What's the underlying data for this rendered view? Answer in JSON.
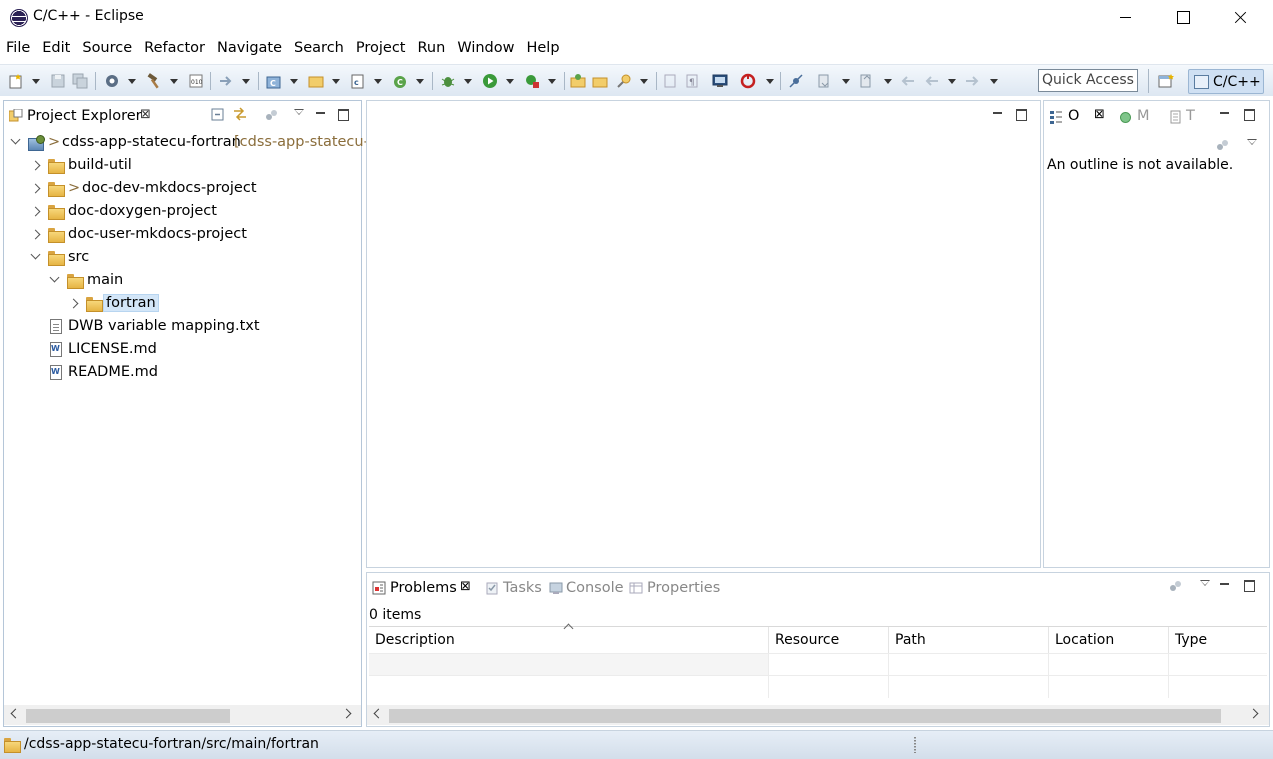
{
  "window": {
    "title": "C/C++ - Eclipse"
  },
  "menu": [
    "File",
    "Edit",
    "Source",
    "Refactor",
    "Navigate",
    "Search",
    "Project",
    "Run",
    "Window",
    "Help"
  ],
  "toolbar": {
    "quick_access_placeholder": "Quick Access",
    "perspective_label": "C/C++"
  },
  "project_explorer": {
    "tab_label": "Project Explorer",
    "tree": [
      {
        "label": "cdss-app-statecu-fortran",
        "suffix": "[cdss-app-statecu-",
        "prefix": ">",
        "level": 0,
        "state": "open",
        "icon": "project-icon"
      },
      {
        "label": "build-util",
        "prefix": "",
        "level": 1,
        "state": "closed",
        "icon": "folder-icon"
      },
      {
        "label": "doc-dev-mkdocs-project",
        "prefix": ">",
        "level": 1,
        "state": "closed",
        "icon": "folder-icon"
      },
      {
        "label": "doc-doxygen-project",
        "prefix": "",
        "level": 1,
        "state": "closed",
        "icon": "folder-icon"
      },
      {
        "label": "doc-user-mkdocs-project",
        "prefix": "",
        "level": 1,
        "state": "closed",
        "icon": "folder-icon"
      },
      {
        "label": "src",
        "prefix": "",
        "level": 1,
        "state": "open",
        "icon": "folder-icon"
      },
      {
        "label": "main",
        "prefix": "",
        "level": 2,
        "state": "open",
        "icon": "folder-icon"
      },
      {
        "label": "fortran",
        "prefix": "",
        "level": 3,
        "state": "closed",
        "icon": "folder-icon",
        "selected": true
      },
      {
        "label": "DWB variable mapping.txt",
        "prefix": "",
        "level": 1,
        "state": "none",
        "icon": "text-file-icon"
      },
      {
        "label": "LICENSE.md",
        "prefix": "",
        "level": 1,
        "state": "none",
        "icon": "markdown-file-icon"
      },
      {
        "label": "README.md",
        "prefix": "",
        "level": 1,
        "state": "none",
        "icon": "markdown-file-icon"
      }
    ]
  },
  "outline": {
    "tabs": [
      "O",
      "M",
      "T"
    ],
    "message": "An outline is not available."
  },
  "problems": {
    "tabs": [
      "Problems",
      "Tasks",
      "Console",
      "Properties"
    ],
    "items_count": "0 items",
    "columns": [
      "Description",
      "Resource",
      "Path",
      "Location",
      "Type"
    ]
  },
  "status": {
    "path": "/cdss-app-statecu-fortran/src/main/fortran"
  }
}
